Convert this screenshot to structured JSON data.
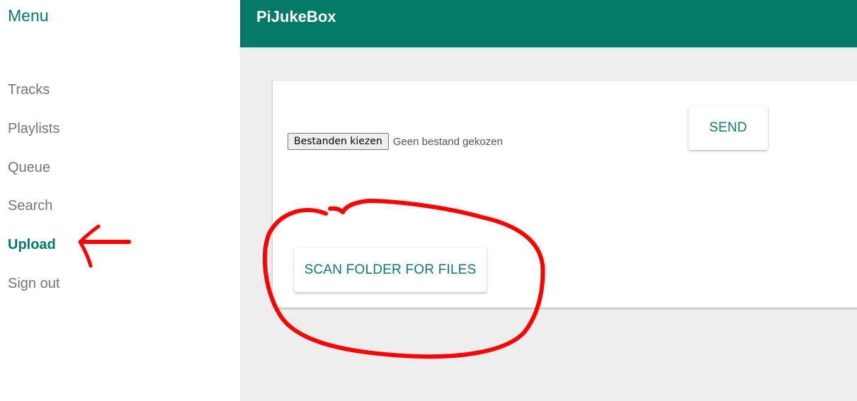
{
  "sidebar": {
    "title": "Menu",
    "items": [
      {
        "label": "Tracks",
        "active": false
      },
      {
        "label": "Playlists",
        "active": false
      },
      {
        "label": "Queue",
        "active": false
      },
      {
        "label": "Search",
        "active": false
      },
      {
        "label": "Upload",
        "active": true
      },
      {
        "label": "Sign out",
        "active": false
      }
    ]
  },
  "header": {
    "title": "PiJukeBox"
  },
  "upload": {
    "file_button_label": "Bestanden kiezen",
    "file_status": "Geen bestand gekozen",
    "send_label": "SEND",
    "scan_label": "SCAN FOLDER FOR FILES"
  },
  "colors": {
    "accent": "#027a6a",
    "background": "#eeeeee",
    "annotation": "#ff0000"
  },
  "icons": {
    "annotation_arrow": "left-arrow-icon",
    "annotation_circle": "circle-highlight-icon"
  }
}
